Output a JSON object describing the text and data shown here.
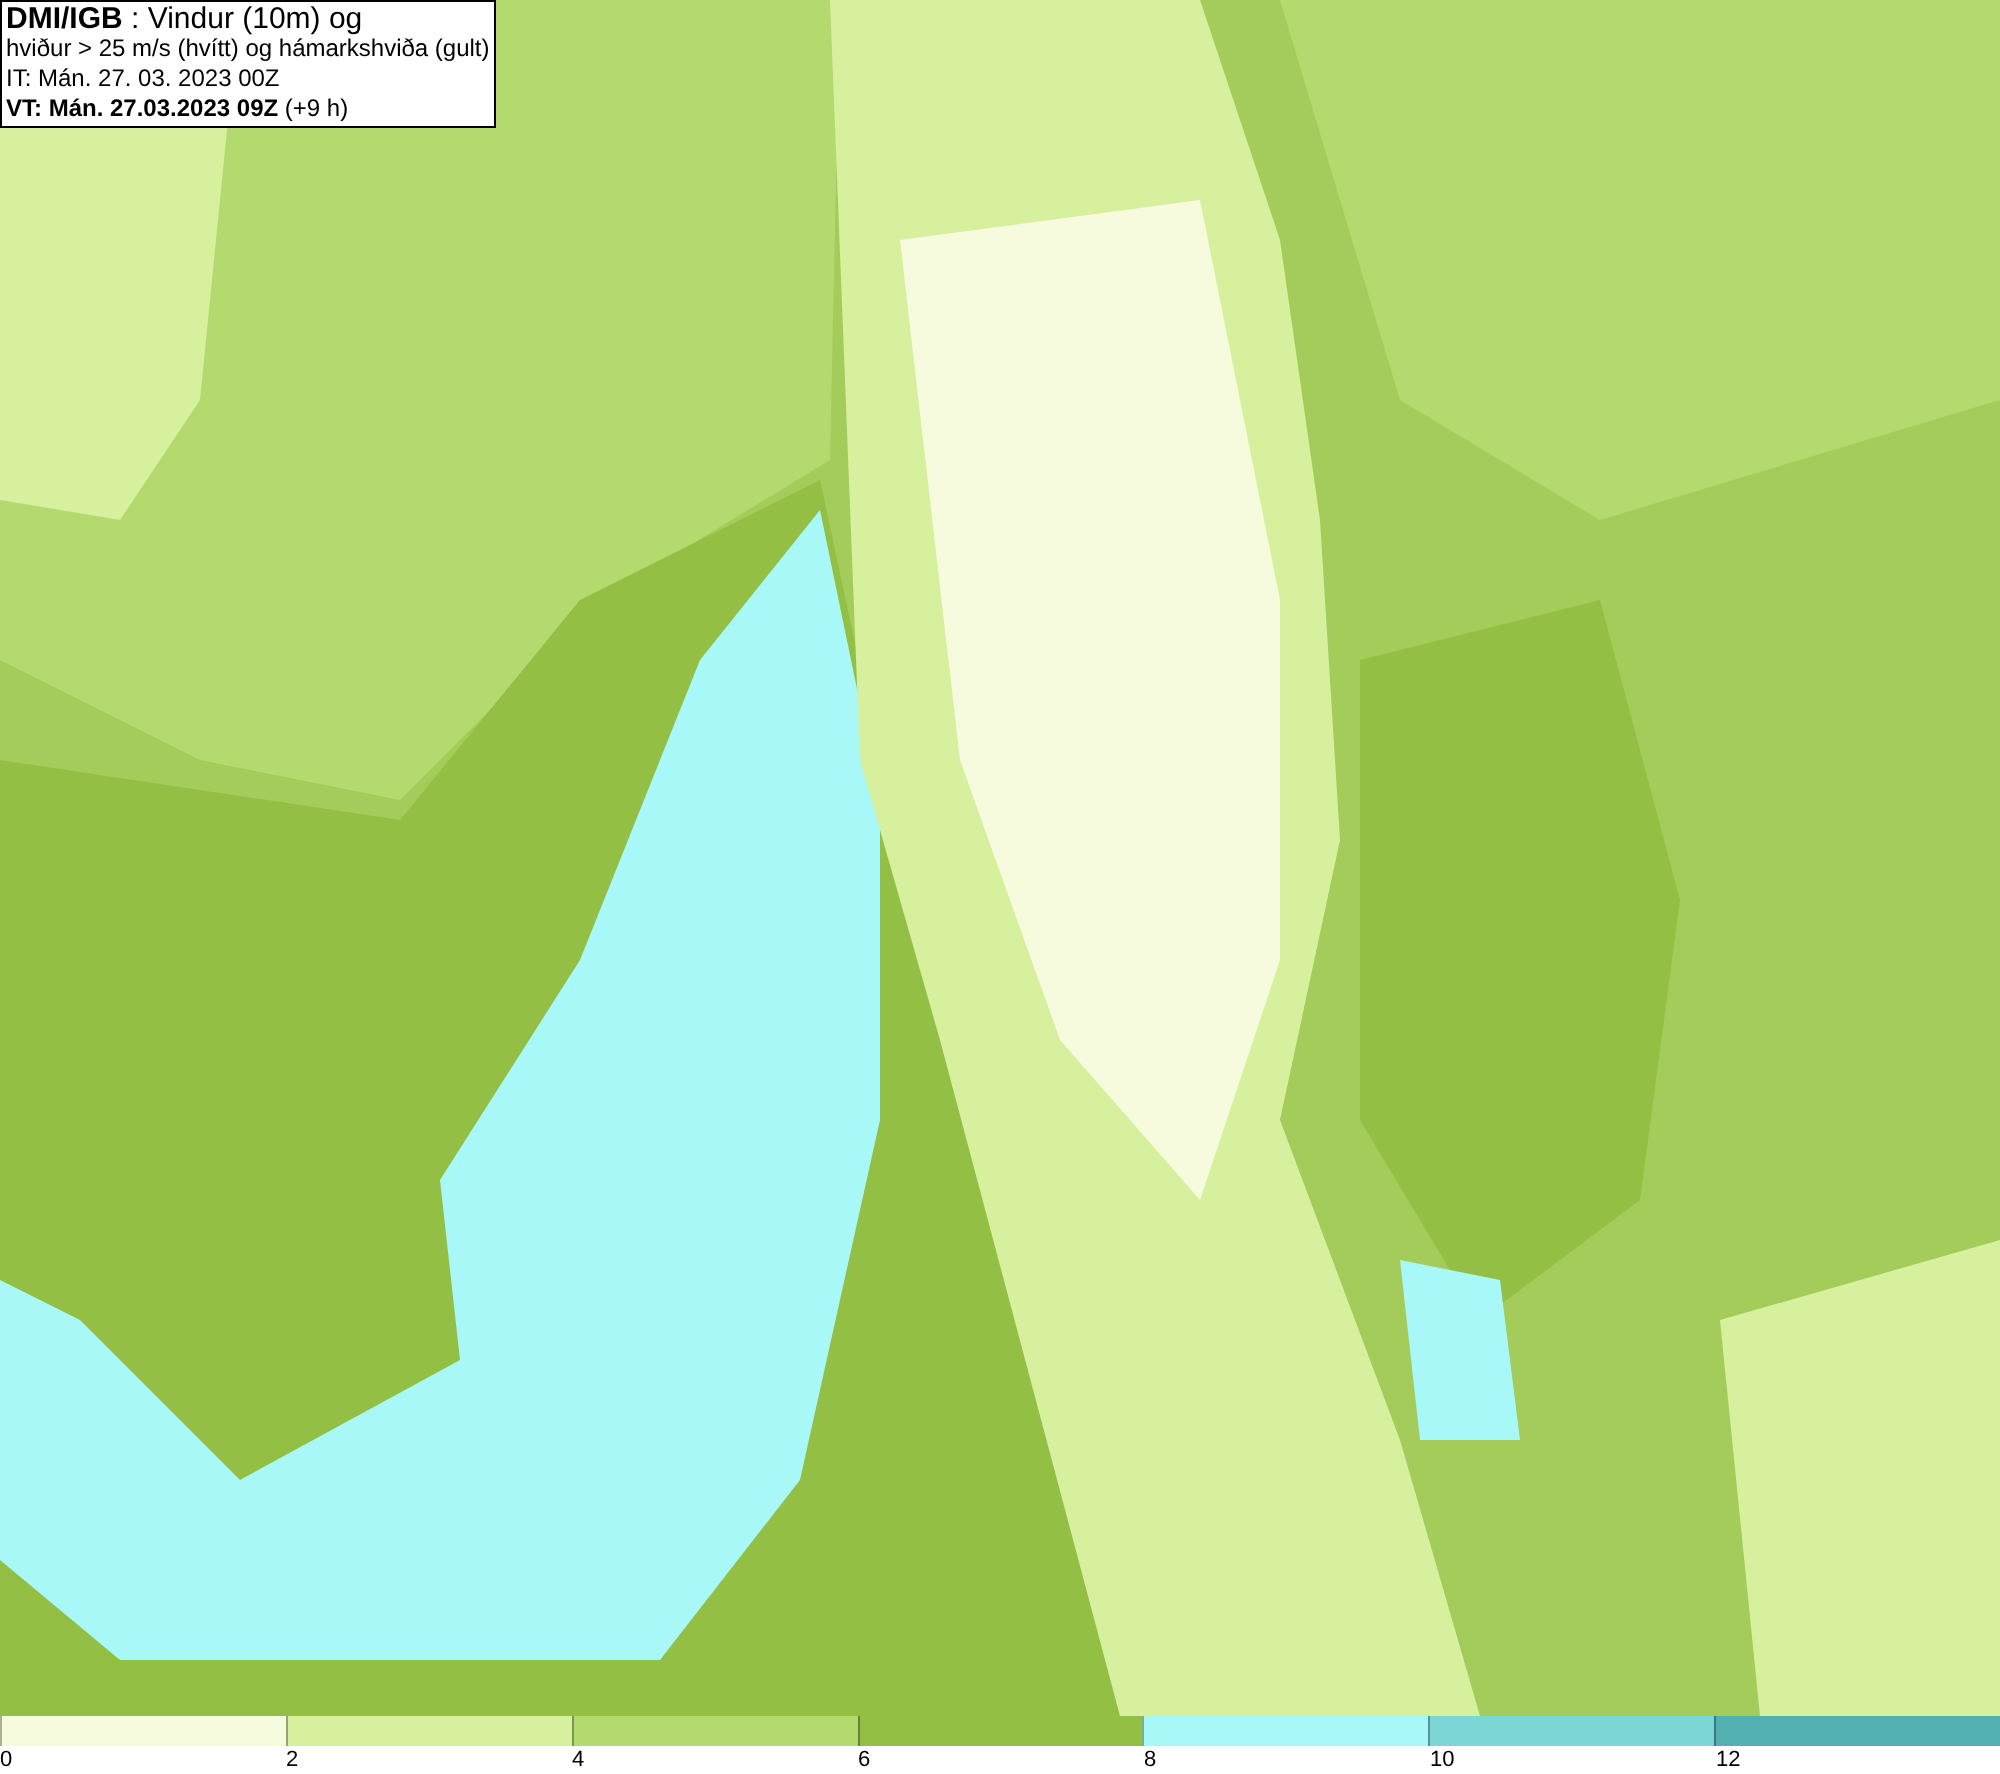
{
  "title_box": {
    "lines": [
      "**DMI/IGB** : Vindur (10m) og",
      "hviður > 25 m/s (hvítt) og hámarkshviða (gult)",
      "IT: Mán. 27. 03. 2023 00Z",
      "**VT: Mán. 27.03.2023 09Z** (+9 h)"
    ]
  },
  "legend": {
    "swatches": [
      {
        "color": "#f5fbdc"
      },
      {
        "color": "#d6f09e"
      },
      {
        "color": "#b4d96e"
      },
      {
        "color": "#93bf44"
      },
      {
        "color": "#a8f8f8"
      },
      {
        "color": "#7dd6d6"
      },
      {
        "color": "#52b0b0"
      }
    ],
    "ticks": [
      "0",
      "2",
      "4",
      "6",
      "8",
      "10",
      "12"
    ]
  }
}
